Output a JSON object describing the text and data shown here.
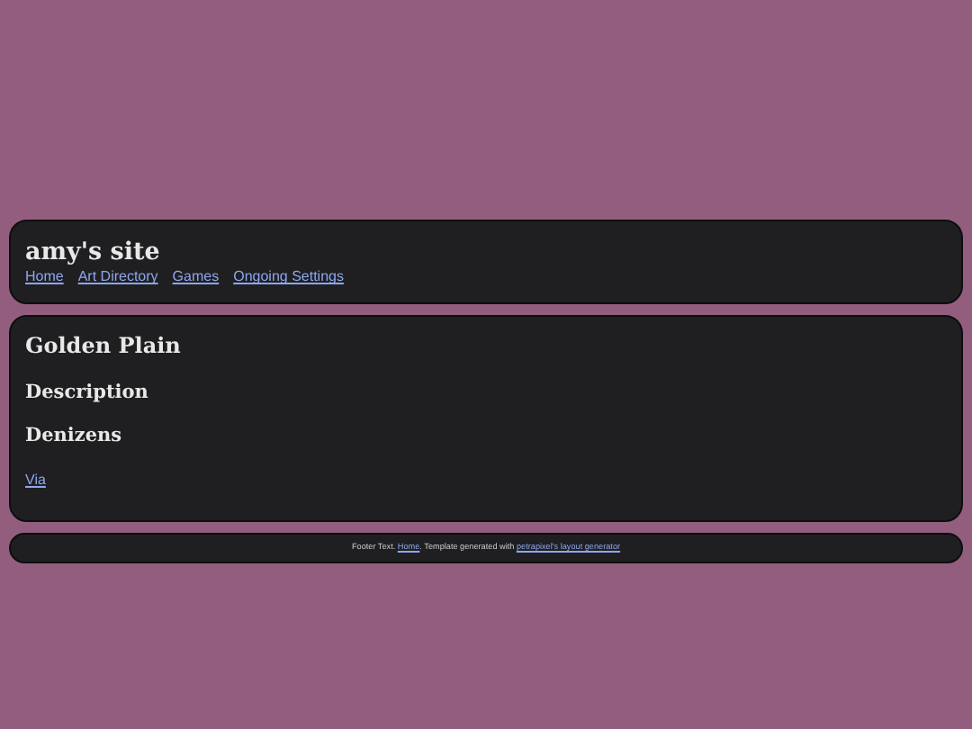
{
  "header": {
    "title": "amy's site",
    "nav": [
      "Home",
      "Art Directory",
      "Games",
      "Ongoing Settings"
    ]
  },
  "main": {
    "title": "Golden Plain",
    "sections": [
      {
        "heading": "Description"
      },
      {
        "heading": "Denizens",
        "links": [
          "Via"
        ]
      }
    ]
  },
  "footer": {
    "parts": [
      {
        "kind": "text",
        "text": "Footer Text. "
      },
      {
        "kind": "link",
        "text": "Home"
      },
      {
        "kind": "text",
        "text": ". Template generated with "
      },
      {
        "kind": "link",
        "text": "petrapixel's layout generator"
      }
    ]
  }
}
